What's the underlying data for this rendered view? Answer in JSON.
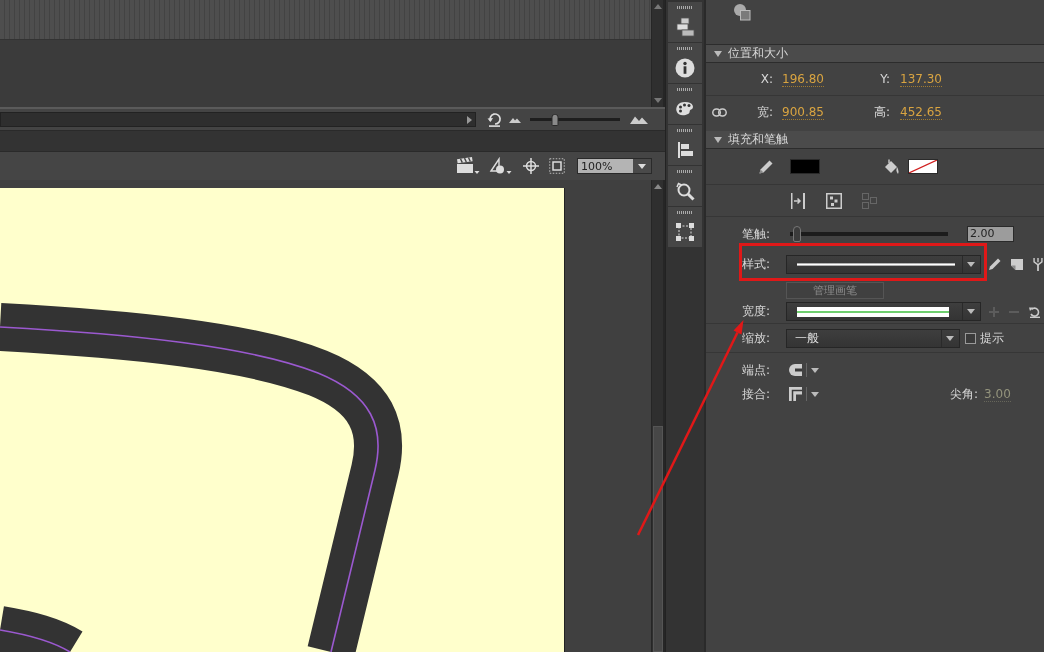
{
  "timeline": {
    "zoom_slider": {
      "level": 0.28
    }
  },
  "stage_toolbar": {
    "zoom": "100%"
  },
  "properties": {
    "position_size": {
      "title": "位置和大小",
      "expanded": true,
      "fields": [
        {
          "label": "X:",
          "value": "196.80"
        },
        {
          "label": "Y:",
          "value": "137.30"
        },
        {
          "label": "宽:",
          "value": "900.85"
        },
        {
          "label": "高:",
          "value": "452.65"
        }
      ]
    },
    "fill_stroke": {
      "title": "填充和笔触",
      "expanded": true,
      "stroke_swatch": {
        "color": "#000000"
      },
      "fill_swatch": {
        "no_fill": true
      },
      "tool_buttons": [
        {
          "kind": "arrow-bar",
          "disabled": false
        },
        {
          "kind": "dotted-square",
          "disabled": false
        },
        {
          "kind": "linked-squares",
          "disabled": true
        }
      ],
      "stroke": {
        "label": "笔触:",
        "level": 0.02,
        "value": "2.00"
      },
      "style": {
        "label": "样式:"
      },
      "manage_brushes": {
        "label": "管理画笔",
        "disabled": true
      },
      "width": {
        "label": "宽度:",
        "add_disabled": true,
        "remove_disabled": true
      },
      "scale": {
        "label": "缩放:",
        "value": "一般"
      },
      "hinting": {
        "label": "提示",
        "checked": false
      },
      "cap": {
        "label": "端点:"
      },
      "join": {
        "label": "接合:"
      },
      "miter": {
        "label": "尖角:",
        "value": "3.00",
        "disabled": true
      }
    }
  }
}
